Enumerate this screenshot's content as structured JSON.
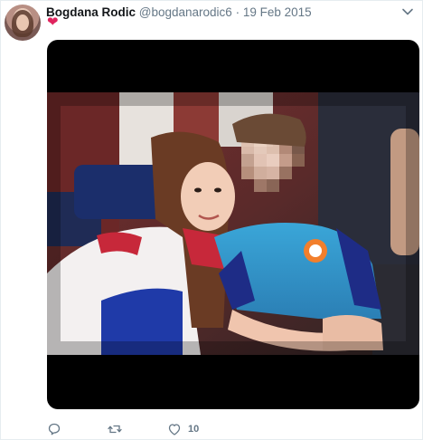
{
  "tweet": {
    "author_name": "Bogdana Rodic",
    "handle": "@bogdanarodic6",
    "separator": "·",
    "date": "19 Feb 2015",
    "text_emoji": "❤",
    "media_alt": "photo-selfie",
    "actions": {
      "reply_icon": "reply-icon",
      "retweet_icon": "retweet-icon",
      "like_icon": "like-icon",
      "like_count": "10"
    }
  },
  "colors": {
    "accent": "#1da1f2",
    "secondary_text": "#657786",
    "heart": "#e0245e",
    "border": "#e6ecf0"
  }
}
